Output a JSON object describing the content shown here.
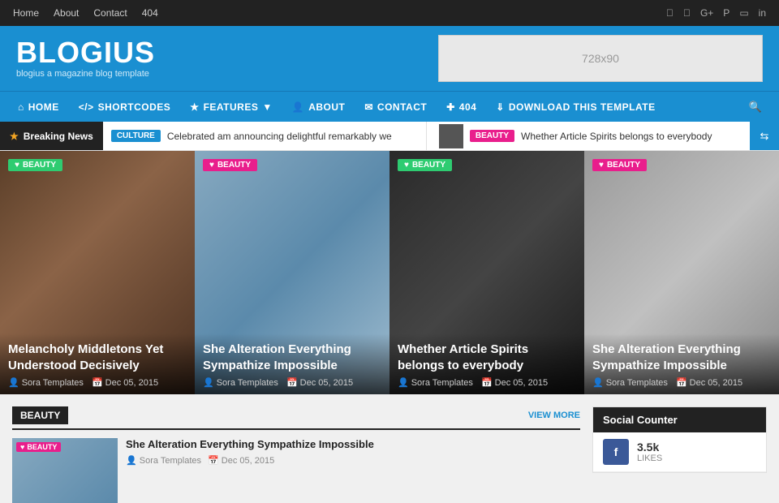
{
  "topbar": {
    "links": [
      "Home",
      "About",
      "Contact",
      "404"
    ],
    "social_icons": [
      "f",
      "t",
      "g+",
      "p",
      "i",
      "in"
    ]
  },
  "header": {
    "logo_title": "BLOGIUS",
    "logo_sub": "blogius a magazine blog template",
    "ad_text": "728x90"
  },
  "mainnav": {
    "items": [
      {
        "label": "HOME",
        "icon": "home"
      },
      {
        "label": "SHORTCODES",
        "icon": "code"
      },
      {
        "label": "FEATURES",
        "icon": "star",
        "has_dropdown": true
      },
      {
        "label": "ABOUT",
        "icon": "user"
      },
      {
        "label": "CONTACT",
        "icon": "envelope"
      },
      {
        "label": "404",
        "icon": "plus"
      },
      {
        "label": "DOWNLOAD THIS TEMPLATE",
        "icon": "download"
      }
    ]
  },
  "breaking_news": {
    "label": "Breaking News",
    "items": [
      {
        "badge": "CULTURE",
        "badge_color": "blue",
        "text": "Celebrated am announcing delightful remarkably we"
      },
      {
        "badge": "BEAUTY",
        "badge_color": "pink",
        "text": "Whether Article Spirits belongs to everybody"
      }
    ]
  },
  "featured": {
    "articles": [
      {
        "category": "BEAUTY",
        "category_color": "beauty",
        "title": "Melancholy Middletons Yet Understood Decisively",
        "author": "Sora Templates",
        "date": "Dec 05, 2015",
        "img_class": "art1"
      },
      {
        "category": "BEAUTY",
        "category_color": "beauty-pink",
        "title": "She Alteration Everything Sympathize Impossible",
        "author": "Sora Templates",
        "date": "Dec 05, 2015",
        "img_class": "art2"
      },
      {
        "category": "BEAUTY",
        "category_color": "beauty",
        "title": "Whether Article Spirits belongs to everybody",
        "author": "Sora Templates",
        "date": "Dec 05, 2015",
        "img_class": "art3"
      },
      {
        "category": "BEAUTY",
        "category_color": "beauty-pink",
        "title": "She Alteration Everything Sympathize Impossible",
        "author": "Sora Templates",
        "date": "Dec 05, 2015",
        "img_class": "art4"
      }
    ]
  },
  "beauty_section": {
    "title": "BEAUTY",
    "view_more": "VIEW MORE",
    "articles": [
      {
        "category": "BEAUTY",
        "title": "She Alteration Everything Sympathize Impossible",
        "author": "Sora Templates",
        "date": "Dec 05, 2015"
      }
    ]
  },
  "social_counter": {
    "title": "Social Counter",
    "items": [
      {
        "platform": "Facebook",
        "count": "3.5k",
        "label": "Likes",
        "icon": "f",
        "color": "#3b5998"
      }
    ]
  }
}
